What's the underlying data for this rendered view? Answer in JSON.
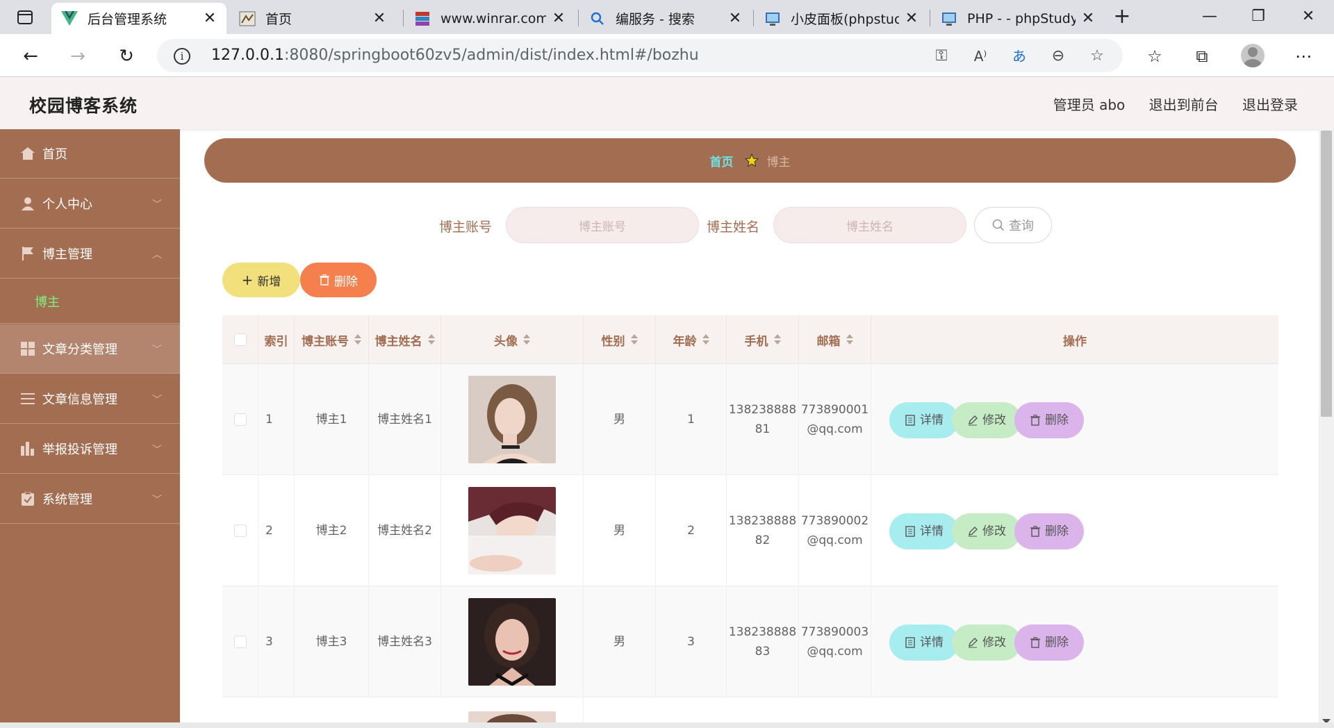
{
  "browser": {
    "tabs": [
      {
        "title": "后台管理系统",
        "active": true
      },
      {
        "title": "首页",
        "active": false
      },
      {
        "title": "www.winrar.com.c",
        "active": false
      },
      {
        "title": "编服务 - 搜索",
        "active": false
      },
      {
        "title": "小皮面板(phpstuc",
        "active": false
      },
      {
        "title": "PHP - - phpStudy",
        "active": false
      }
    ],
    "url_host": "127.0.0.1",
    "url_rest": ":8080/springboot60zv5/admin/dist/index.html#/bozhu"
  },
  "header": {
    "logo": "校园博客系统",
    "user": "管理员 abo",
    "front_link": "退出到前台",
    "logout": "退出登录"
  },
  "sidebar": {
    "items": [
      {
        "label": "首页",
        "icon": "home-icon"
      },
      {
        "label": "个人中心",
        "icon": "user-icon"
      },
      {
        "label": "博主管理",
        "icon": "flag-icon"
      },
      {
        "label": "文章分类管理",
        "icon": "grid-icon"
      },
      {
        "label": "文章信息管理",
        "icon": "list-icon"
      },
      {
        "label": "举报投诉管理",
        "icon": "chart-icon"
      },
      {
        "label": "系统管理",
        "icon": "clipboard-icon"
      }
    ],
    "sub_active": "博主"
  },
  "breadcrumb": {
    "home": "首页",
    "current": "博主"
  },
  "search": {
    "account_label": "博主账号",
    "account_placeholder": "博主账号",
    "name_label": "博主姓名",
    "name_placeholder": "博主姓名",
    "button": "查询"
  },
  "actions": {
    "add": "新增",
    "delete": "删除"
  },
  "table": {
    "headers": [
      "索引",
      "博主账号",
      "博主姓名",
      "头像",
      "性别",
      "年龄",
      "手机",
      "邮箱",
      "操作"
    ],
    "rows": [
      {
        "index": "1",
        "account": "博主1",
        "name": "博主姓名1",
        "gender": "男",
        "age": "1",
        "phone1": "138238888",
        "phone2": "81",
        "email1": "773890001",
        "email2": "@qq.com"
      },
      {
        "index": "2",
        "account": "博主2",
        "name": "博主姓名2",
        "gender": "男",
        "age": "2",
        "phone1": "138238888",
        "phone2": "82",
        "email1": "773890002",
        "email2": "@qq.com"
      },
      {
        "index": "3",
        "account": "博主3",
        "name": "博主姓名3",
        "gender": "男",
        "age": "3",
        "phone1": "138238888",
        "phone2": "83",
        "email1": "773890003",
        "email2": "@qq.com"
      }
    ],
    "op_detail": "详情",
    "op_edit": "修改",
    "op_delete": "删除"
  },
  "colors": {
    "primary": "#a36d52",
    "header_bg": "#f7f2f1",
    "active_sub": "#7ff27f",
    "breadcrumb_home": "#6ee2e2"
  }
}
